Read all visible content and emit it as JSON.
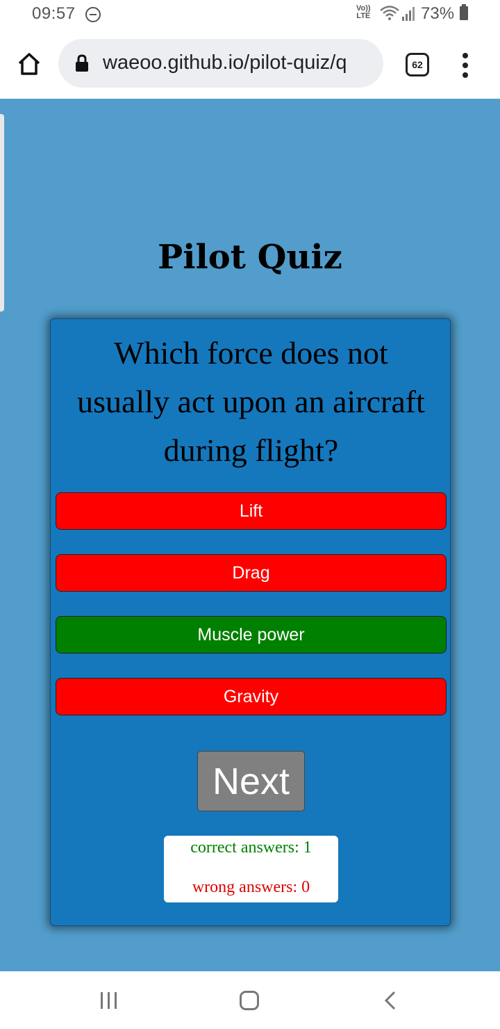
{
  "status_bar": {
    "time": "09:57",
    "network_label_top": "Vo))",
    "network_label_bottom": "LTE",
    "battery": "73%",
    "icons": [
      "do-not-disturb-icon",
      "wifi-icon",
      "signal-icon",
      "battery-icon"
    ]
  },
  "browser": {
    "url": "waeoo.github.io/pilot-quiz/q",
    "tab_count": "62",
    "icons": [
      "home-icon",
      "lock-icon",
      "more-vert-icon"
    ]
  },
  "page": {
    "title": "Pilot Quiz",
    "question": "Which force does not usually act upon an aircraft during flight?",
    "answers": [
      {
        "label": "Lift",
        "state": "wrong",
        "color": "#ff0000"
      },
      {
        "label": "Drag",
        "state": "wrong",
        "color": "#ff0000"
      },
      {
        "label": "Muscle power",
        "state": "correct",
        "color": "#008000"
      },
      {
        "label": "Gravity",
        "state": "wrong",
        "color": "#ff0000"
      }
    ],
    "next_label": "Next",
    "score": {
      "correct_text": "correct answers: 1",
      "wrong_text": "wrong answers: 0",
      "correct_color": "#008000",
      "wrong_color": "#e00000"
    },
    "colors": {
      "page_background": "#529dcb",
      "card_background": "#1578bd",
      "next_button": "#808080"
    }
  },
  "nav_bar": {
    "icons": [
      "recent-apps-icon",
      "home-nav-icon",
      "back-icon"
    ]
  }
}
